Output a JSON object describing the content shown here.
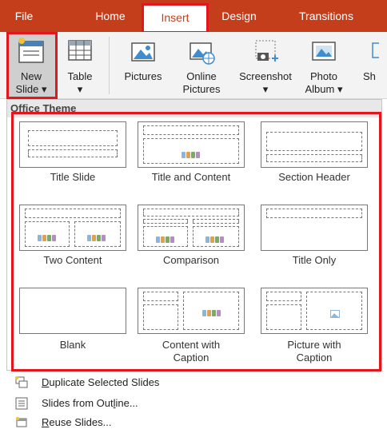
{
  "tabs": {
    "file": "File",
    "home": "Home",
    "insert": "Insert",
    "design": "Design",
    "transitions": "Transitions"
  },
  "ribbon": {
    "new_slide_line1": "New",
    "new_slide_line2": "Slide",
    "table": "Table",
    "pictures": "Pictures",
    "online_line1": "Online",
    "online_line2": "Pictures",
    "screenshot": "Screenshot",
    "photo_line1": "Photo",
    "photo_line2": "Album",
    "cut_off": "Sh"
  },
  "gallery": {
    "header": "Office Theme",
    "layouts": [
      {
        "caption1": "Title Slide"
      },
      {
        "caption1": "Title and Content"
      },
      {
        "caption1": "Section Header"
      },
      {
        "caption1": "Two Content"
      },
      {
        "caption1": "Comparison"
      },
      {
        "caption1": "Title Only"
      },
      {
        "caption1": "Blank"
      },
      {
        "caption1": "Content with",
        "caption2": "Caption"
      },
      {
        "caption1": "Picture with",
        "caption2": "Caption"
      }
    ]
  },
  "menu": {
    "duplicate_pre": "",
    "duplicate_key": "D",
    "duplicate_post": "uplicate Selected Slides",
    "outline_pre": "Slides from Out",
    "outline_key": "l",
    "outline_post": "ine...",
    "reuse_pre": "",
    "reuse_key": "R",
    "reuse_post": "euse Slides..."
  },
  "colors": {
    "accent": "#c43e1c",
    "highlight_box": "#e3161d"
  }
}
